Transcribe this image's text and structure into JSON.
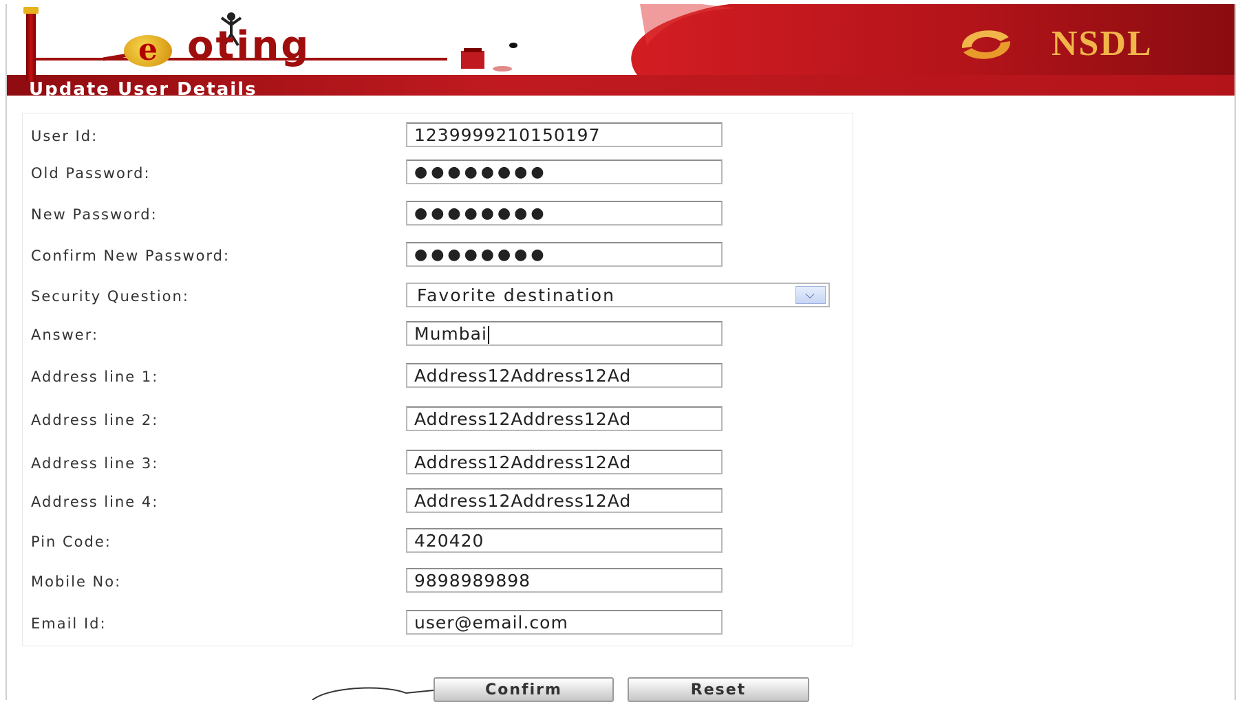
{
  "header": {
    "brand_text": "oting",
    "brand_letter": "e",
    "page_title": "Update User Details",
    "partner_logo_text": "NSDL",
    "colors": {
      "banner_red": "#b3141a",
      "logo_gold": "#f2b54a"
    }
  },
  "form": {
    "fields": [
      {
        "label": "User Id:",
        "value": "1239999210150197"
      },
      {
        "label": "Old Password:",
        "value": "●●●●●●●●"
      },
      {
        "label": "New Password:",
        "value": "●●●●●●●●"
      },
      {
        "label": "Confirm New Password:",
        "value": "●●●●●●●●"
      },
      {
        "label": "Security Question:",
        "value": "Favorite destination"
      },
      {
        "label": "Answer:",
        "value": "Mumbai"
      },
      {
        "label": "Address line 1:",
        "value": "Address12Address12Ad"
      },
      {
        "label": "Address line 2:",
        "value": "Address12Address12Ad"
      },
      {
        "label": "Address line 3:",
        "value": "Address12Address12Ad"
      },
      {
        "label": "Address line 4:",
        "value": "Address12Address12Ad"
      },
      {
        "label": "Pin Code:",
        "value": "420420"
      },
      {
        "label": "Mobile No:",
        "value": "9898989898"
      },
      {
        "label": "Email Id:",
        "value": "user@email.com"
      }
    ]
  },
  "actions": {
    "confirm_label": "Confirm",
    "reset_label": "Reset"
  }
}
